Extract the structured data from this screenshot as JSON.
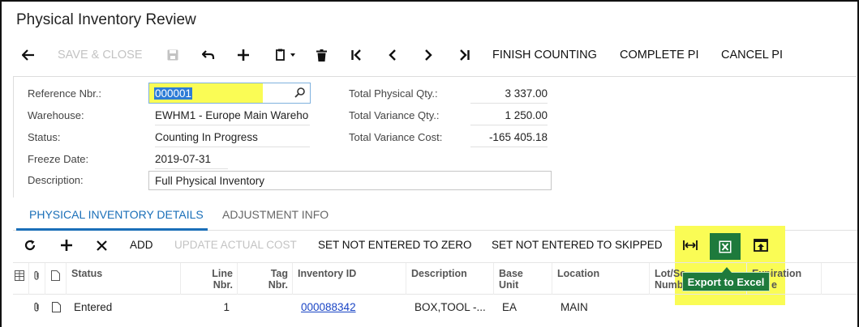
{
  "page_title": "Physical Inventory Review",
  "toolbar": {
    "save_close": "SAVE & CLOSE",
    "finish_counting": "FINISH COUNTING",
    "complete_pi": "COMPLETE PI",
    "cancel_pi": "CANCEL PI"
  },
  "form": {
    "reference_label": "Reference Nbr.:",
    "reference_value": "000001",
    "warehouse_label": "Warehouse:",
    "warehouse_value": "EWHM1 - Europe Main Wareho",
    "status_label": "Status:",
    "status_value": "Counting In Progress",
    "freeze_label": "Freeze Date:",
    "freeze_value": "2019-07-31",
    "description_label": "Description:",
    "description_value": "Full Physical Inventory",
    "total_physical_label": "Total Physical Qty.:",
    "total_physical_value": "3 337.00",
    "total_variance_qty_label": "Total Variance Qty.:",
    "total_variance_qty_value": "1 250.00",
    "total_variance_cost_label": "Total Variance Cost:",
    "total_variance_cost_value": "-165 405.18"
  },
  "tabs": {
    "details": "PHYSICAL INVENTORY DETAILS",
    "adjustment": "ADJUSTMENT INFO"
  },
  "grid_toolbar": {
    "add": "ADD",
    "update_actual_cost": "UPDATE ACTUAL COST",
    "set_zero": "SET NOT ENTERED TO ZERO",
    "set_skipped": "SET NOT ENTERED TO SKIPPED",
    "tooltip": "Export to Excel"
  },
  "grid": {
    "headers": {
      "status": "Status",
      "line_nbr_1": "Line",
      "line_nbr_2": "Nbr.",
      "tag_nbr_1": "Tag",
      "tag_nbr_2": "Nbr.",
      "inventory_id": "Inventory ID",
      "description": "Description",
      "base_unit_1": "Base",
      "base_unit_2": "Unit",
      "location": "Location",
      "lot_serial_1": "Lot/Se",
      "lot_serial_2": "Numb",
      "expiration_1": "Expiration",
      "expiration_2": "e"
    },
    "rows": [
      {
        "status": "Entered",
        "line_nbr": "1",
        "inventory_id": "000088342",
        "description": "BOX,TOOL -...",
        "base_unit": "EA",
        "location": "MAIN"
      }
    ]
  },
  "colors": {
    "accent": "#1a6fb8",
    "highlight": "#fafc55",
    "excel_green": "#1e7a3c"
  }
}
